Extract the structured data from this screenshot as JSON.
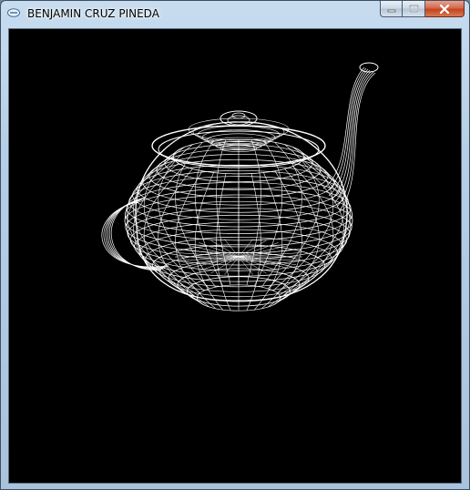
{
  "window": {
    "title": "BENJAMIN CRUZ PINEDA",
    "icon": "opengl-app-icon",
    "buttons": [
      {
        "name": "minimize-button",
        "icon": "minimize-icon"
      },
      {
        "name": "maximize-button",
        "icon": "maximize-icon"
      },
      {
        "name": "close-button",
        "icon": "close-icon"
      }
    ]
  },
  "scene": {
    "object": "wireframe teapot",
    "background_color": "#000000",
    "line_color": "#ffffff"
  }
}
